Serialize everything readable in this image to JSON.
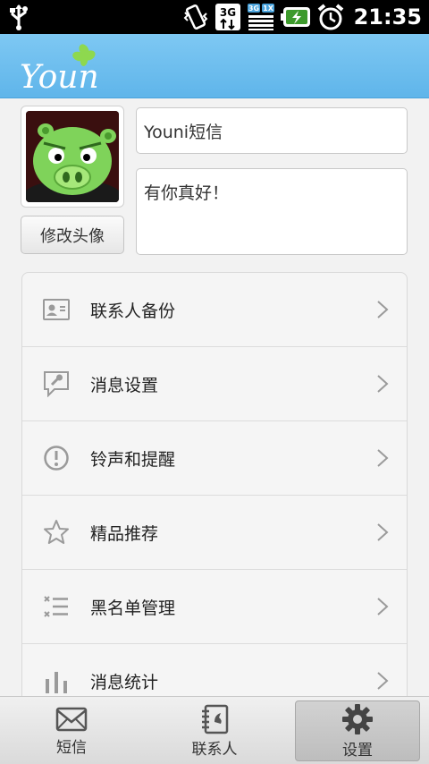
{
  "status_bar": {
    "time": "21:35",
    "icons": [
      "usb-icon",
      "vibrate-icon",
      "3g-data-icon",
      "signal-3g-1x-icon",
      "battery-charging-icon",
      "alarm-icon"
    ],
    "network_label": "3G",
    "network_sub": "1X"
  },
  "header": {
    "logo_text": "Youni"
  },
  "profile": {
    "change_avatar_label": "修改头像",
    "name_value": "Youni短信",
    "signature_value": "有你真好！"
  },
  "menu": {
    "items": [
      {
        "label": "联系人备份",
        "icon": "contact-card-icon"
      },
      {
        "label": "消息设置",
        "icon": "message-wrench-icon"
      },
      {
        "label": "铃声和提醒",
        "icon": "alert-circle-icon"
      },
      {
        "label": "精品推荐",
        "icon": "star-icon"
      },
      {
        "label": "黑名单管理",
        "icon": "blacklist-icon"
      },
      {
        "label": "消息统计",
        "icon": "bar-chart-icon"
      }
    ]
  },
  "tabs": [
    {
      "label": "短信",
      "icon": "envelope-icon",
      "active": false
    },
    {
      "label": "联系人",
      "icon": "address-book-icon",
      "active": false
    },
    {
      "label": "设置",
      "icon": "gear-icon",
      "active": true
    }
  ],
  "colors": {
    "header": "#6bbdee",
    "accent_green": "#7dd04a"
  }
}
